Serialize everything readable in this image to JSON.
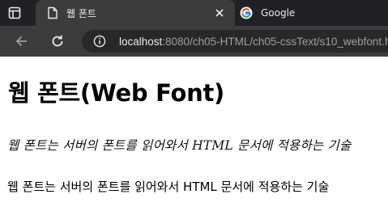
{
  "browser": {
    "tabs": [
      {
        "title": "웹 폰트",
        "active": true,
        "icon": "document-icon"
      },
      {
        "title": "Google",
        "active": false,
        "icon": "google-icon"
      }
    ],
    "address": {
      "host": "localhost",
      "rest": ":8080/ch05-HTML/ch05-cssText/s10_webfont.html"
    }
  },
  "page": {
    "heading": "웹 폰트(Web Font)",
    "webfont_text": "웹 폰트는 서버의 폰트를 읽어와서 HTML 문서에 적용하는 기술",
    "plain_text": "웹 폰트는 서버의 폰트를 읽어와서 HTML 문서에 적용하는 기술"
  },
  "colors": {
    "chrome_bg": "#202124",
    "tab_active_bg": "#3c3c3c",
    "omnibox_bg": "#282828",
    "text_light": "#e8eaed",
    "text_dim": "#9aa0a6"
  }
}
